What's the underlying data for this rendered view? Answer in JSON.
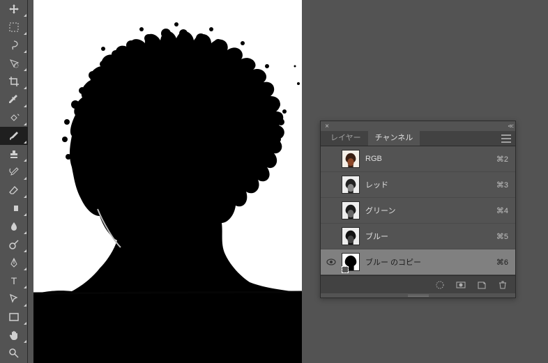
{
  "panel": {
    "tabs": {
      "layers": "レイヤー",
      "channels": "チャンネル"
    },
    "channels": [
      {
        "name": "RGB",
        "shortcut": "⌘2",
        "visible": false,
        "selected": false,
        "thumb": "color"
      },
      {
        "name": "レッド",
        "shortcut": "⌘3",
        "visible": false,
        "selected": false,
        "thumb": "gray"
      },
      {
        "name": "グリーン",
        "shortcut": "⌘4",
        "visible": false,
        "selected": false,
        "thumb": "gray"
      },
      {
        "name": "ブルー",
        "shortcut": "⌘5",
        "visible": false,
        "selected": false,
        "thumb": "gray"
      },
      {
        "name": "ブルー のコピー",
        "shortcut": "⌘6",
        "visible": true,
        "selected": true,
        "thumb": "bw"
      }
    ]
  },
  "tools": [
    "move",
    "rect-marquee",
    "lasso",
    "quick-select",
    "crop",
    "eyedropper",
    "spot-heal",
    "brush",
    "stamp",
    "history-brush",
    "eraser",
    "gradient",
    "blur",
    "dodge",
    "pen",
    "type",
    "path-select",
    "rectangle",
    "hand",
    "zoom"
  ]
}
